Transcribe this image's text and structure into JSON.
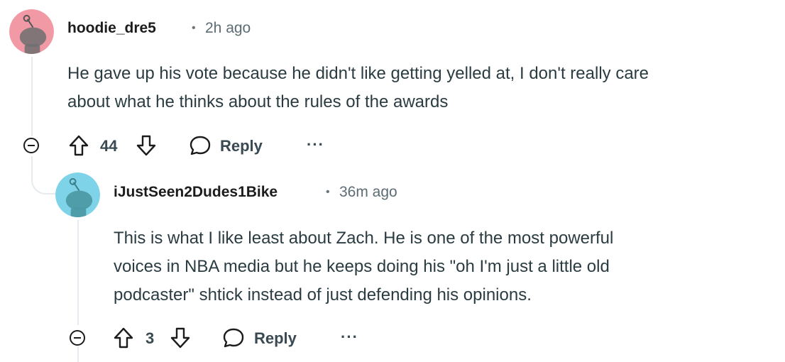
{
  "comments": [
    {
      "username": "hoodie_dre5",
      "separator": "•",
      "time": "2h ago",
      "body_lines": [
        "He gave up his vote because he didn't like getting yelled at, I don't really care",
        "about what he thinks about the rules of the awards"
      ],
      "score": "44",
      "reply_label": "Reply",
      "more_label": "···",
      "avatar_color": "#f19aa6"
    },
    {
      "username": "iJustSeen2Dudes1Bike",
      "separator": "•",
      "time": "36m ago",
      "body_lines": [
        "This is what I like least about Zach. He is one of the most powerful",
        "voices in NBA media but he keeps doing his \"oh I'm just a little old",
        "podcaster\" shtick instead of just defending his opinions."
      ],
      "score": "3",
      "reply_label": "Reply",
      "more_label": "···",
      "avatar_color": "#7fd3e8"
    }
  ],
  "icons": [
    "avatar-snoo-icon",
    "collapse-icon",
    "upvote-icon",
    "downvote-icon",
    "reply-bubble-icon",
    "more-icon"
  ]
}
